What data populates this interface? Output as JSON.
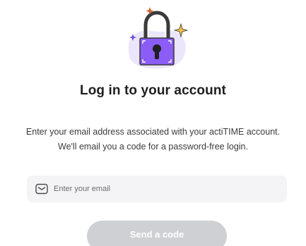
{
  "header": {
    "title": "Log in to your account"
  },
  "description": {
    "line1": "Enter your email address associated with your actiTIME account.",
    "line2": "We'll email you a code for a password-free login."
  },
  "email_field": {
    "placeholder": "Enter your email",
    "value": "",
    "icon": "envelope-icon"
  },
  "send_button": {
    "label": "Send a code",
    "state": "disabled"
  },
  "illustration": {
    "icon": "padlock-icon",
    "colors": {
      "lock_body": "#8b5cf6",
      "shackle": "#3a3a3a",
      "blob": "#e9e4fb",
      "sparkle_orange": "#d9622b",
      "sparkle_yellow": "#f2b233",
      "sparkle_purple": "#6a4bd8"
    }
  },
  "colors": {
    "title": "#1f1f1f",
    "text": "#3b3b3b",
    "input_bg": "#f4f4f6",
    "button_disabled": "#cfd0d4"
  }
}
